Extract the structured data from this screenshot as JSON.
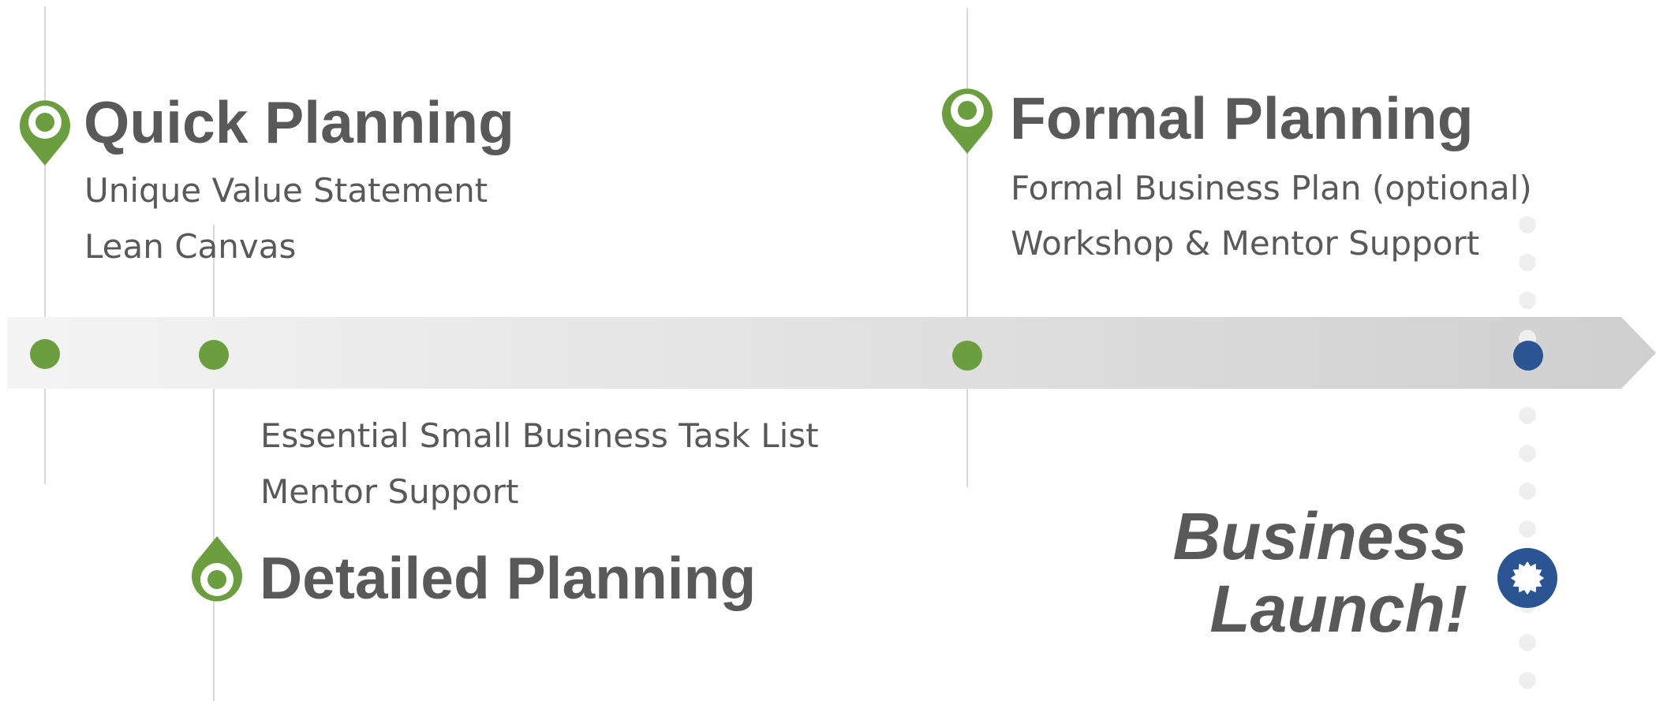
{
  "timeline": {
    "stages": [
      {
        "title": "Quick Planning",
        "items": [
          "Unique Value Statement",
          "Lean Canvas"
        ]
      },
      {
        "title": "Detailed Planning",
        "items": [
          "Essential Small Business Task List",
          "Mentor Support"
        ]
      },
      {
        "title": "Formal Planning",
        "items": [
          "Formal Business Plan (optional)",
          "Workshop & Mentor Support"
        ]
      }
    ],
    "launch": {
      "line1": "Business",
      "line2": "Launch!"
    }
  },
  "colors": {
    "milestone_green": "#6a9e3f",
    "launch_blue": "#2a5592",
    "text_gray": "#595959",
    "arrow_light": "#f2f2f2",
    "arrow_dark": "#d0d0d0"
  },
  "icons": {
    "stage_marker": "map-pin-icon",
    "launch_marker": "rosette-badge-icon"
  }
}
